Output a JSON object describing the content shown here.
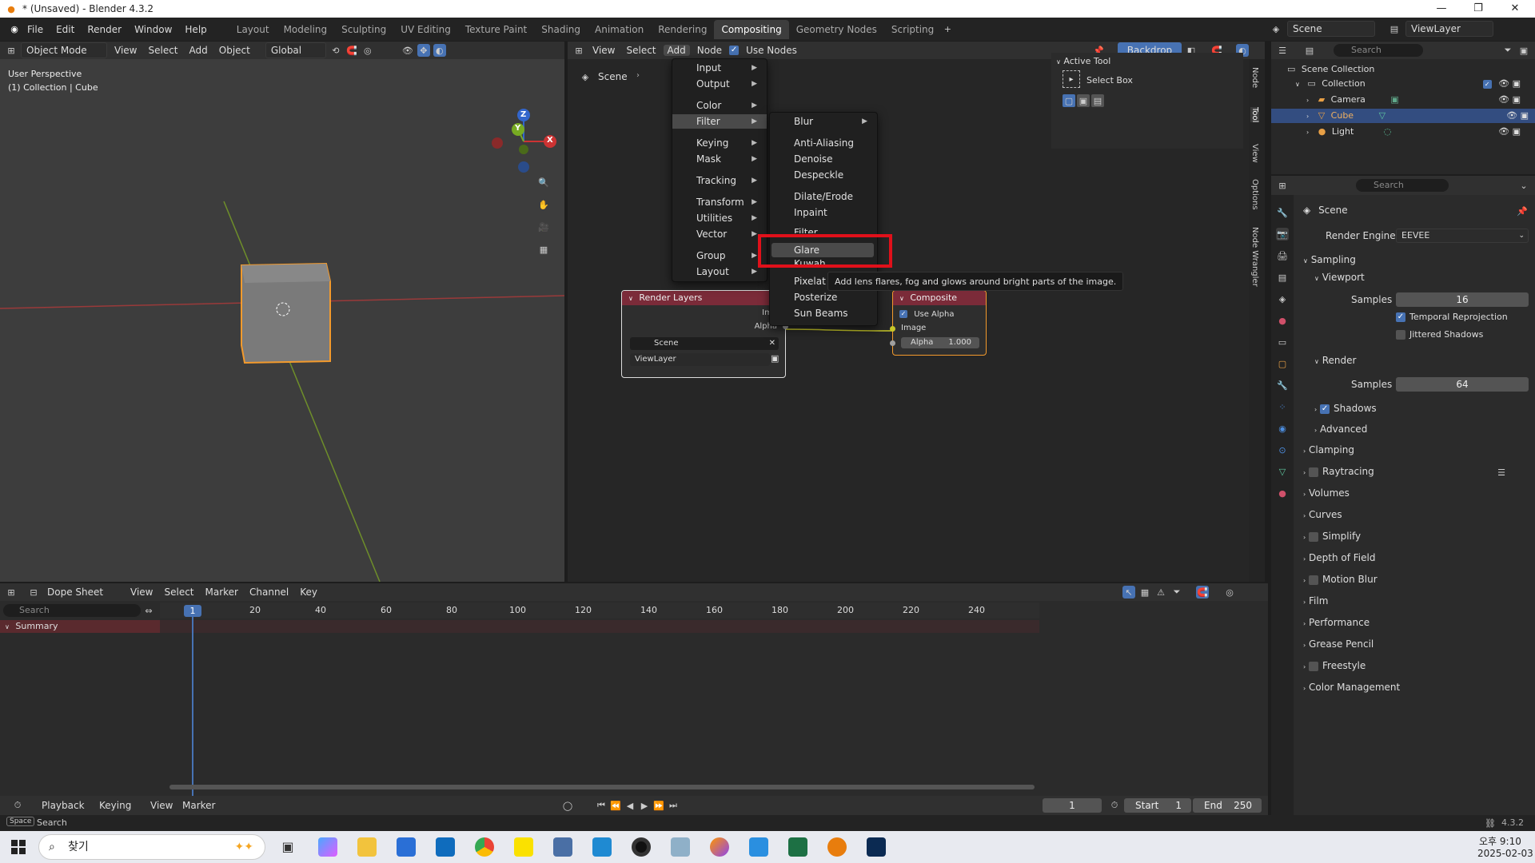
{
  "window": {
    "title": "* (Unsaved) - Blender 4.3.2"
  },
  "menubar": {
    "items": [
      "File",
      "Edit",
      "Render",
      "Window",
      "Help"
    ]
  },
  "workspaces": [
    "Layout",
    "Modeling",
    "Sculpting",
    "UV Editing",
    "Texture Paint",
    "Shading",
    "Animation",
    "Rendering",
    "Compositing",
    "Geometry Nodes",
    "Scripting"
  ],
  "active_workspace": "Compositing",
  "topright": {
    "scene": "Scene",
    "view_layer": "ViewLayer"
  },
  "viewport": {
    "mode": "Object Mode",
    "menu": [
      "View",
      "Select",
      "Add",
      "Object"
    ],
    "orientation": "Global",
    "overlay_title": "User Perspective",
    "overlay_sub": "(1) Collection | Cube",
    "gizmo": {
      "x": "X",
      "y": "Y",
      "z": "Z"
    }
  },
  "node_editor": {
    "menu": [
      "View",
      "Select",
      "Add",
      "Node"
    ],
    "use_nodes": "Use Nodes",
    "backdrop": "Backdrop",
    "breadcrumb": "Scene",
    "active_tool_title": "Active Tool",
    "active_tool_name": "Select Box",
    "side_tabs": [
      "Node",
      "Tool",
      "View",
      "Options",
      "Node Wrangler"
    ],
    "render_layers": {
      "title": "Render Layers",
      "out_image": "Ima",
      "out_alpha": "Alpha",
      "scene": "Scene",
      "view_layer": "ViewLayer"
    },
    "composite": {
      "title": "Composite",
      "use_alpha": "Use Alpha",
      "image": "Image",
      "alpha_label": "Alpha",
      "alpha_value": "1.000"
    }
  },
  "add_menu": {
    "items": [
      "Input",
      "Output",
      "Color",
      "Filter",
      "Keying",
      "Mask",
      "Tracking",
      "Transform",
      "Utilities",
      "Vector",
      "Group",
      "Layout"
    ],
    "highlighted": "Filter"
  },
  "filter_menu": {
    "items": [
      "Blur",
      "Anti-Aliasing",
      "Denoise",
      "Despeckle",
      "Dilate/Erode",
      "Inpaint",
      "Filter",
      "Glare",
      "Kuwah",
      "Pixelate",
      "Posterize",
      "Sun Beams"
    ],
    "highlighted": "Glare",
    "tooltip": "Add lens flares, fog and glows around bright parts of the image."
  },
  "outliner": {
    "search": "Search",
    "root": "Scene Collection",
    "collection": "Collection",
    "items": [
      "Camera",
      "Cube",
      "Light"
    ],
    "selected": "Cube"
  },
  "properties": {
    "search": "Search",
    "context": "Scene",
    "render_engine_label": "Render Engine",
    "render_engine": "EEVEE",
    "sampling": "Sampling",
    "viewport": "Viewport",
    "samples_label": "Samples",
    "viewport_samples": "16",
    "temporal": "Temporal Reprojection",
    "jittered": "Jittered Shadows",
    "render": "Render",
    "render_samples": "64",
    "shadows": "Shadows",
    "advanced": "Advanced",
    "panels": [
      "Clamping",
      "Raytracing",
      "Volumes",
      "Curves",
      "Simplify",
      "Depth of Field",
      "Motion Blur",
      "Film",
      "Performance",
      "Grease Pencil",
      "Freestyle",
      "Color Management"
    ]
  },
  "dopesheet": {
    "mode": "Dope Sheet",
    "menu": [
      "View",
      "Select",
      "Marker",
      "Channel",
      "Key"
    ],
    "search": "Search",
    "summary": "Summary",
    "current_frame": "1",
    "ticks": [
      "20",
      "40",
      "60",
      "80",
      "100",
      "120",
      "140",
      "160",
      "180",
      "200",
      "220",
      "240"
    ]
  },
  "timeline": {
    "menu": [
      "Playback",
      "Keying",
      "View",
      "Marker"
    ],
    "frame": "1",
    "start_label": "Start",
    "start": "1",
    "end_label": "End",
    "end": "250"
  },
  "statusbar": {
    "key": "Space",
    "action": "Search",
    "version": "4.3.2"
  },
  "taskbar": {
    "search": "찾기",
    "time": "오후 9:10",
    "date": "2025-02-03"
  }
}
